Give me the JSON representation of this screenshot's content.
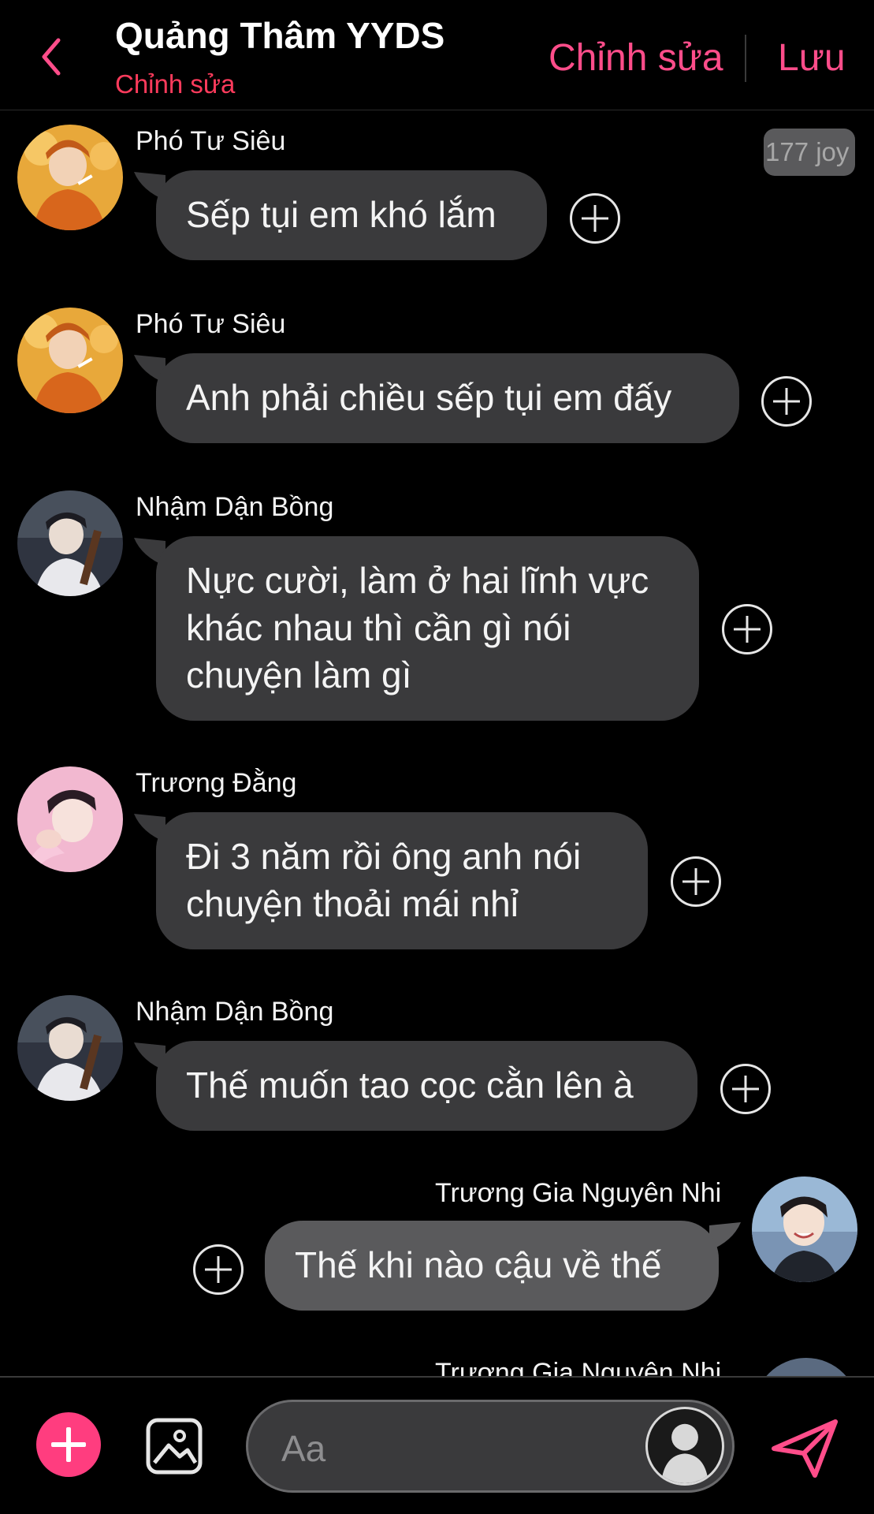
{
  "header": {
    "title": "Quảng Thâm YYDS",
    "subtitle": "Chỉnh sửa",
    "edit_label": "Chỉnh sửa",
    "save_label": "Lưu"
  },
  "badge": "177 joy",
  "messages": [
    {
      "sender": "Phó Tư Siêu",
      "lines": [
        "Sếp tụi em khó lắm"
      ],
      "side": "left"
    },
    {
      "sender": "Phó Tư Siêu",
      "lines": [
        "Anh phải chiều sếp tụi em đấy"
      ],
      "side": "left"
    },
    {
      "sender": "Nhậm Dận Bồng",
      "lines": [
        "Nực cười, làm ở hai lĩnh vực",
        "khác nhau thì cần gì nói",
        "chuyện làm gì"
      ],
      "side": "left"
    },
    {
      "sender": "Trương Đằng",
      "lines": [
        "Đi 3 năm rồi ông anh nói",
        "chuyện thoải mái nhỉ"
      ],
      "side": "left"
    },
    {
      "sender": "Nhậm Dận Bồng",
      "lines": [
        "Thế muốn tao cọc cằn lên à"
      ],
      "side": "left"
    },
    {
      "sender": "Trương Gia Nguyên Nhi",
      "lines": [
        "Thế khi nào cậu về thế"
      ],
      "side": "right"
    }
  ],
  "peek_sender": "Trương Gia Nguyên Nhi",
  "composer": {
    "placeholder": "Aa"
  },
  "colors": {
    "accent": "#ff4d8a",
    "subtitle": "#ff3b5c",
    "bubble": "#3a3a3c",
    "background": "#000000"
  },
  "icons": [
    "back-chevron-icon",
    "plus-circle-icon",
    "add-icon",
    "image-icon",
    "profile-avatar-icon",
    "send-icon"
  ]
}
